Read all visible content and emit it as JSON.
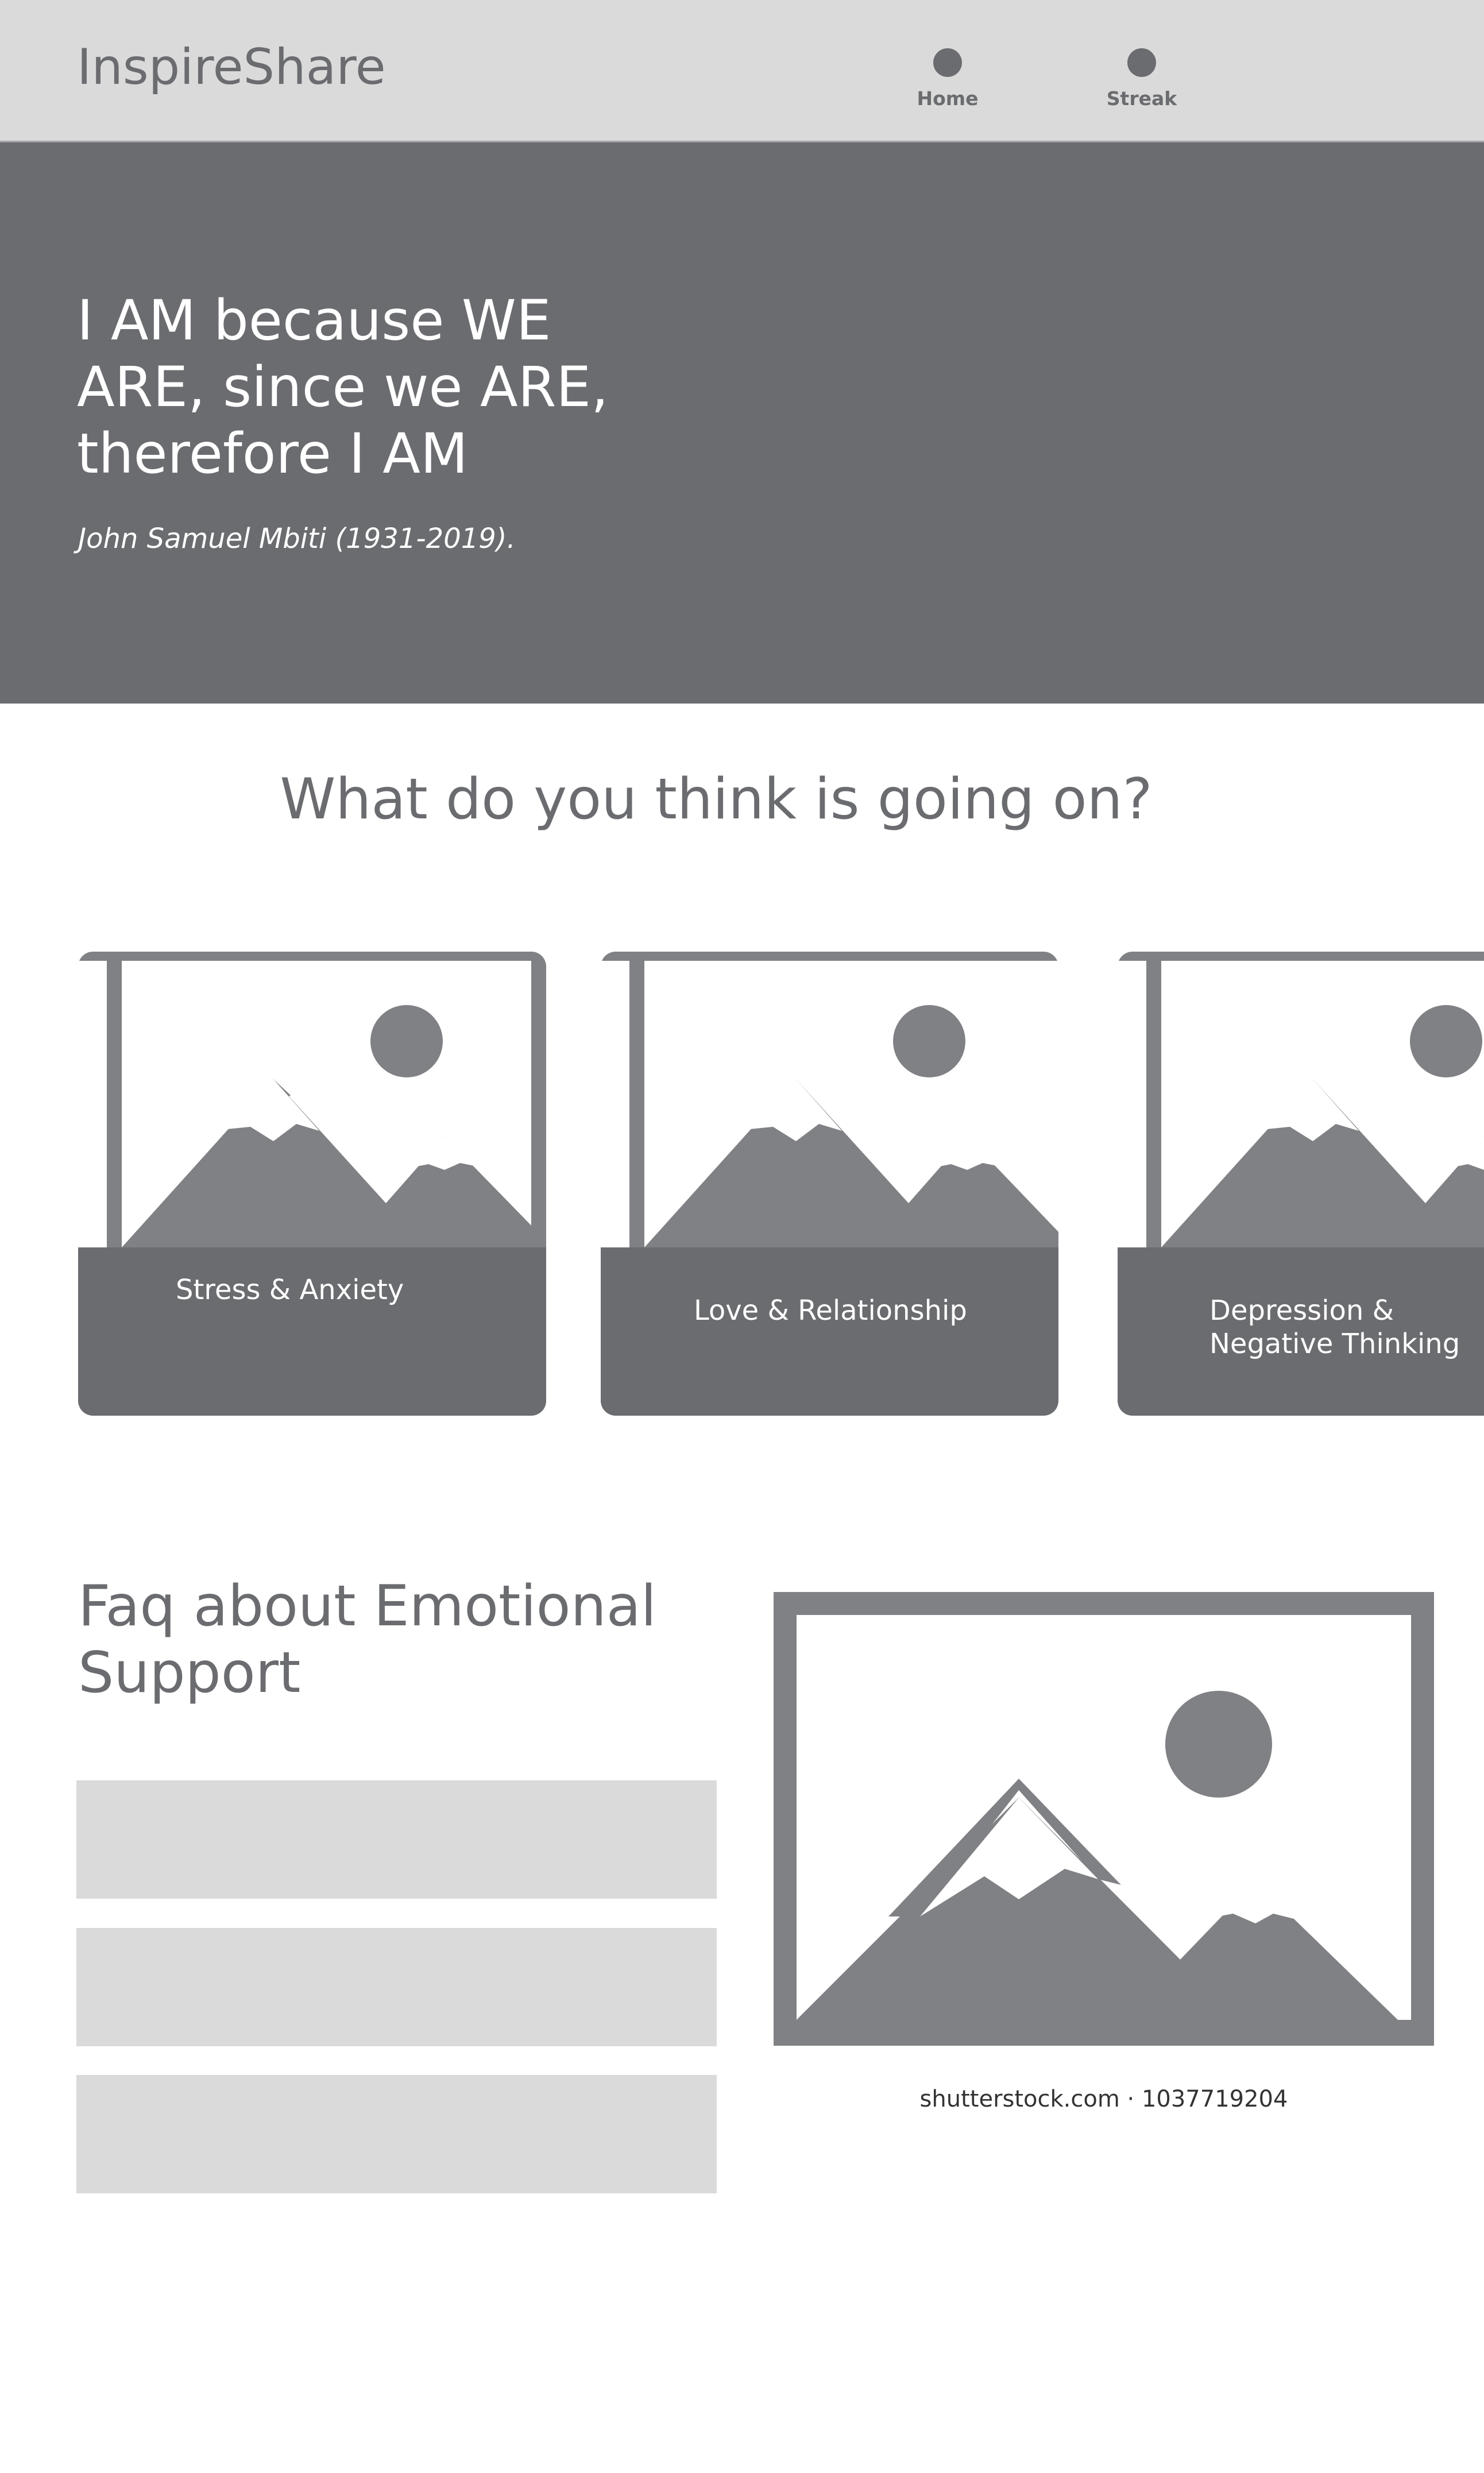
{
  "app": {
    "brand": "InspireShare"
  },
  "nav": {
    "items": [
      {
        "label": "Home",
        "icon": "circle-icon"
      },
      {
        "label": "Streak",
        "icon": "circle-icon"
      }
    ]
  },
  "hero": {
    "quote": "I AM because WE ARE, since we ARE, therefore I AM",
    "author": "John Samuel Mbiti (1931-2019)."
  },
  "topics": {
    "title": "What do you think is going on?",
    "cards": [
      {
        "label": "Stress & Anxiety",
        "image": "image-placeholder-icon"
      },
      {
        "label": "Love & Relationship",
        "image": "image-placeholder-icon"
      },
      {
        "label": "Depression & Negative Thinking",
        "image": "image-placeholder-icon"
      }
    ]
  },
  "faq": {
    "title": "Faq about Emotional Support",
    "items": [
      "",
      "",
      ""
    ],
    "image": "image-placeholder-icon",
    "image_caption": "shutterstock.com · 1037719204"
  },
  "colors": {
    "header_bg": "#dadada",
    "hero_bg": "#6b6c70",
    "text_gray": "#6b6c70",
    "placeholder_gray": "#808184",
    "faq_item_bg": "#dadada",
    "white": "#ffffff"
  }
}
